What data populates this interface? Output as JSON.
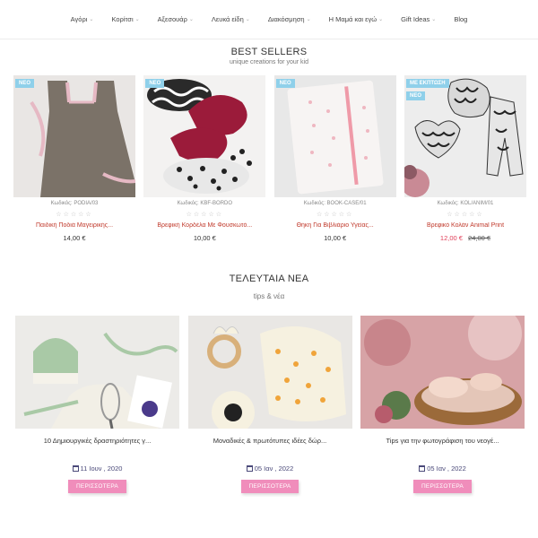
{
  "nav": {
    "items": [
      {
        "label": "Αγόρι",
        "chevron": true
      },
      {
        "label": "Κορίτσι",
        "chevron": true
      },
      {
        "label": "Αξεσουάρ",
        "chevron": true
      },
      {
        "label": "Λευκά είδη",
        "chevron": true
      },
      {
        "label": "Διακόσμηση",
        "chevron": true
      },
      {
        "label": "Η Μαμά και εγώ",
        "chevron": true
      },
      {
        "label": "Gift Ideas",
        "chevron": true
      },
      {
        "label": "Blog",
        "chevron": false
      }
    ]
  },
  "bestsellers": {
    "title": "BEST SELLERS",
    "subtitle": "unique creations for your kid",
    "products": [
      {
        "badges": [
          "ΝΕΟ"
        ],
        "code": "Κωδικός: PODIA/03",
        "stars": "☆☆☆☆☆",
        "name": "Παιδική Ποδιά Μαγειρικής...",
        "price": "14,00 €",
        "old_price": ""
      },
      {
        "badges": [
          "ΝΕΟ"
        ],
        "code": "Κωδικός: KBF-BORDO",
        "stars": "☆☆☆☆☆",
        "name": "Βρεφική Κορδέλα Με Φουσκωτό...",
        "price": "10,00 €",
        "old_price": ""
      },
      {
        "badges": [
          "ΝΕΟ"
        ],
        "code": "Κωδικός: BOOK-CASE/01",
        "stars": "☆☆☆☆☆",
        "name": "Θήκη Για Βιβλιάριο Υγείας...",
        "price": "10,00 €",
        "old_price": ""
      },
      {
        "badges": [
          "ΜΕ ΕΚΠΤΩΣΗ",
          "ΝΕΟ"
        ],
        "code": "Κωδικός: KOL/ANIM/01",
        "stars": "☆☆☆☆☆",
        "name": "Βρεφικό Κολάν Animal Print",
        "price": "12,00 €",
        "old_price": "24,00 €"
      }
    ]
  },
  "news": {
    "title": "ΤΕΛΕΥΤΑΙΑ ΝΕΑ",
    "subtitle": "tips & νέα",
    "posts": [
      {
        "title": "10 Δημιουργικές δραστηριότητες γ...",
        "date": "11 Ιουν , 2020",
        "button": "ΠΕΡΙΣΣΟΤΕΡΑ"
      },
      {
        "title": "Μοναδικές & πρωτότυπες ιδέες δώρ...",
        "date": "05 Ιαν , 2022",
        "button": "ΠΕΡΙΣΣΟΤΕΡΑ"
      },
      {
        "title": "Tips για την φωτογράφιση του νεογέ...",
        "date": "05 Ιαν , 2022",
        "button": "ΠΕΡΙΣΣΟΤΕΡΑ"
      }
    ]
  },
  "colors": {
    "accent_pink": "#f08dbb",
    "badge_blue": "#8fd0ea",
    "product_name_red": "#c0392b",
    "sale_price": "#e0405a",
    "date_color": "#4b4a7a"
  }
}
